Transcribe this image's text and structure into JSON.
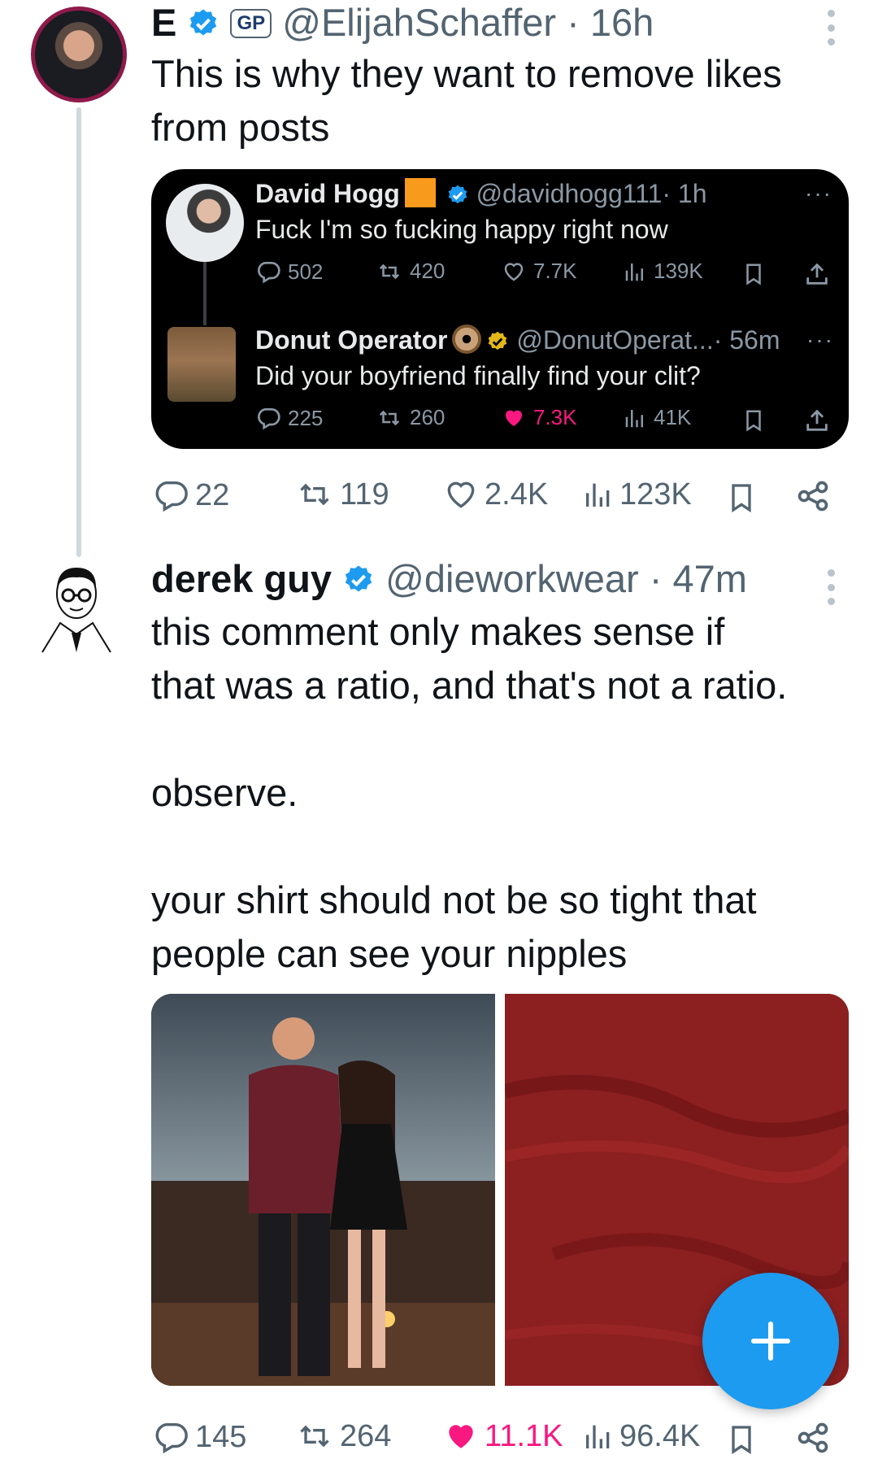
{
  "tweet1": {
    "display_name": "E",
    "badge_text": "GP",
    "handle": "@ElijahSchaffer",
    "separator": "·",
    "time": "16h",
    "text_line1": "This is why they want to remove likes",
    "text_line2": "from posts"
  },
  "quote": {
    "post1": {
      "name": "David Hogg",
      "handle": "@davidhogg111",
      "time": "· 1h",
      "text": "Fuck I'm so fucking happy right now",
      "replies": "502",
      "reposts": "420",
      "likes": "7.7K",
      "views": "139K"
    },
    "post2": {
      "name": "Donut Operator",
      "handle": "@DonutOperat...",
      "time": "· 56m",
      "text": "Did your boyfriend finally find your clit?",
      "replies": "225",
      "reposts": "260",
      "likes": "7.3K",
      "views": "41K"
    },
    "more": "···"
  },
  "tweet1_actions": {
    "replies": "22",
    "reposts": "119",
    "likes": "2.4K",
    "views": "123K"
  },
  "tweet2": {
    "display_name": "derek guy",
    "handle": "@dieworkwear",
    "separator": "·",
    "time": "47m",
    "line1": "this comment only makes sense if",
    "line2": "that was a ratio, and that's not a ratio.",
    "line3": "observe.",
    "line4": "your shirt should not be so tight that",
    "line5": "people can see your nipples"
  },
  "tweet2_actions": {
    "replies": "145",
    "reposts": "264",
    "likes": "11.1K",
    "views": "96.4K"
  },
  "colors": {
    "verified_blue": "#1d9bf0",
    "gold_check": "#e2b719",
    "like_pink": "#f91880",
    "text_gray": "#536471"
  }
}
